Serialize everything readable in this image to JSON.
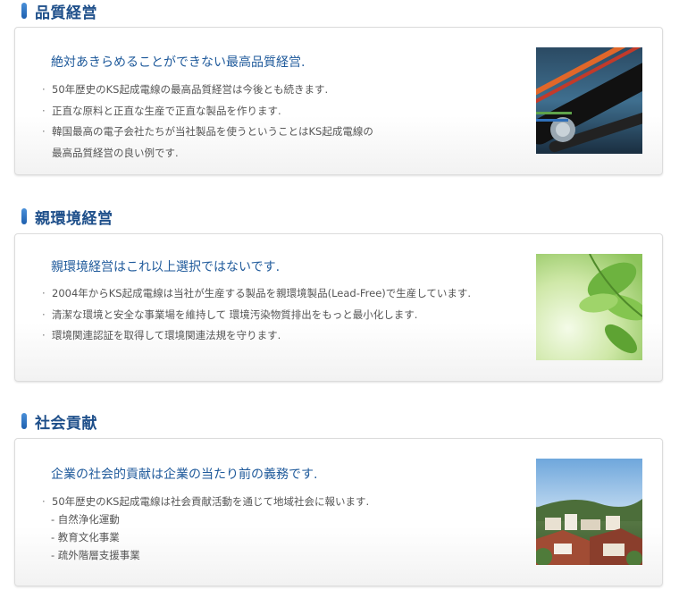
{
  "sections": [
    {
      "title": "品質経営",
      "lead": "絶対あきらめることができない最高品質経営.",
      "items": [
        "50年歴史のKS起成電線の最高品質経営は今後とも続きます.",
        "正直な原料と正直な生産で正直な製品を作ります.",
        "韓国最高の電子会社たちが当社製品を使うということはKS起成電線の",
        "最高品質経営の良い例です."
      ]
    },
    {
      "title": "親環境経営",
      "lead": "親環境経営はこれ以上選択ではないです.",
      "items": [
        "2004年からKS起成電線は当社が生産する製品を親環境製品(Lead-Free)で生産しています.",
        "清潔な環境と安全な事業場を維持して 環境汚染物質排出をもっと最小化します.",
        "環境関連認証を取得して環境関連法規を守ります."
      ]
    },
    {
      "title": "社会貢献",
      "lead": "企業の社会的貢献は企業の当たり前の義務です.",
      "items": [
        "50年歴史のKS起成電線は社会貢献活動を通じて地域社会に報います.",
        "- 自然浄化運動",
        "- 教育文化事業",
        "- 疏外階層支援事業"
      ]
    }
  ],
  "colors": {
    "heading": "#1e4f8a",
    "lead": "#1f5a9b",
    "accent_bar": "#2f74c4"
  },
  "images": [
    "cable-photo",
    "green-leaves-photo",
    "town-photo"
  ]
}
